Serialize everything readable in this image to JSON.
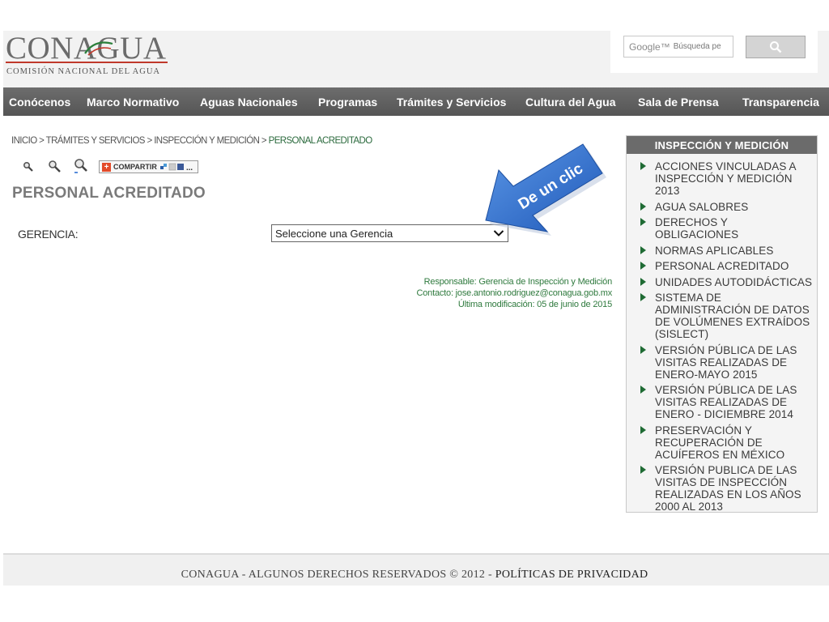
{
  "header": {
    "logo_word": "CONAGUA",
    "logo_subtitle": "COMISIÓN NACIONAL DEL AGUA",
    "search_brand": "Google™",
    "search_placeholder": "Búsqueda pe",
    "search_icon": "magnifier-icon"
  },
  "nav": {
    "items": [
      "Conócenos",
      "Marco Normativo",
      "Aguas Nacionales",
      "Programas",
      "Trámites y Servicios",
      "Cultura del Agua",
      "Sala de Prensa",
      "Transparencia"
    ]
  },
  "breadcrumb": {
    "inicio": "INICIO",
    "tramites": "TRÁMITES Y SERVICIOS",
    "inspeccion": "INSPECCIÓN Y MEDICIÓN",
    "current": "PERSONAL ACREDITADO",
    "separator": " > "
  },
  "tools": {
    "share_label": "COMPARTIR",
    "icons": [
      "zoom-out-icon",
      "zoom-reset-icon",
      "zoom-in-icon",
      "share-icon"
    ]
  },
  "main": {
    "title": "PERSONAL ACREDITADO",
    "gerencia_label": "GERENCIA:",
    "gerencia_selected": "Seleccione una Gerencia",
    "callout": "De un clic",
    "responsable": "Responsable: Gerencia de Inspección y Medición",
    "contacto": "Contacto: jose.antonio.rodriguez@conagua.gob.mx",
    "modificacion": "Última modificación: 05 de junio de 2015"
  },
  "sidebar": {
    "title": "INSPECCIÓN Y MEDICIÓN",
    "items": [
      "ACCIONES VINCULADAS A INSPECCIÓN Y MEDICIÓN 2013",
      "AGUA SALOBRES",
      "DERECHOS Y OBLIGACIONES",
      "NORMAS APLICABLES",
      "PERSONAL ACREDITADO",
      "UNIDADES AUTODIDÁCTICAS",
      "SISTEMA DE ADMINISTRACIÓN DE DATOS DE VOLÚMENES EXTRAÍDOS (SISLECT)",
      "VERSIÓN PÚBLICA DE LAS VISITAS REALIZADAS DE ENERO-MAYO 2015",
      "VERSIÓN PÚBLICA DE LAS VISITAS REALIZADAS DE ENERO - DICIEMBRE 2014",
      "PRESERVACIÓN Y RECUPERACIÓN DE ACUÍFEROS EN MÉXICO",
      "VERSIÓN PUBLICA DE LAS VISITAS DE INSPECCIÓN REALIZADAS EN LOS AÑOS 2000 AL 2013"
    ]
  },
  "footer": {
    "text": "CONAGUA - ALGUNOS DERECHOS RESERVADOS © 2012 - ",
    "link": "POLÍTICAS DE PRIVACIDAD"
  },
  "colors": {
    "nav_bg": "#5f5f5f",
    "accent_green": "#2f7a3e",
    "callout_blue": "#2f6fd0",
    "logo_red": "#c0392b"
  }
}
